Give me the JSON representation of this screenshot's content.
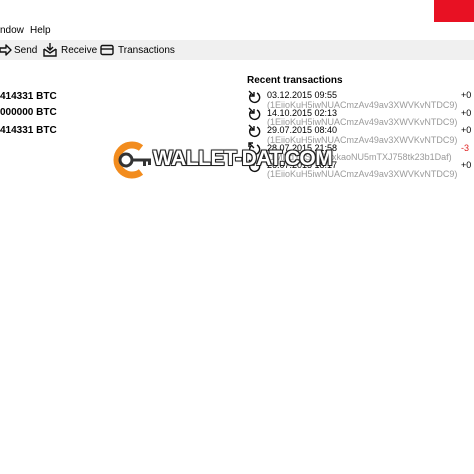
{
  "menu": {
    "window_label": "ndow",
    "help_label": "Help"
  },
  "toolbar": {
    "send_label": "Send",
    "receive_label": "Receive",
    "transactions_label": "Transactions"
  },
  "overview": {
    "balances": [
      "414331 BTC",
      "000000 BTC",
      "414331 BTC"
    ],
    "recent_title": "Recent transactions",
    "transactions": [
      {
        "date": "03.12.2015 09:55",
        "address": "(1EiioKuH5iwNUACmzAv49av3XWVKvNTDC9)",
        "amount": "+0",
        "negative": false
      },
      {
        "date": "14.10.2015 02:13",
        "address": "(1EiioKuH5iwNUACmzAv49av3XWVKvNTDC9)",
        "amount": "+0",
        "negative": false
      },
      {
        "date": "29.07.2015 08:40",
        "address": "(1EiioKuH5iwNUACmzAv49av3XWVKvNTDC9)",
        "amount": "+0",
        "negative": false
      },
      {
        "date": "28.07.2015 21:58",
        "address": "(1MNdY6S232ExkaoNU5mTXJ758tk23b1Daf)",
        "amount": "-3",
        "negative": true
      },
      {
        "date": "26.07.2015 18:17",
        "address": "(1EiioKuH5iwNUACmzAv49av3XWVKvNTDC9)",
        "amount": "+0",
        "negative": false
      }
    ]
  },
  "watermark": {
    "text": "WALLET-DAT.COM",
    "color": "#f28c1e"
  },
  "colors": {
    "negative_amount": "#e02020",
    "address_gray": "#9a9a9a",
    "close_button": "#e81123"
  }
}
